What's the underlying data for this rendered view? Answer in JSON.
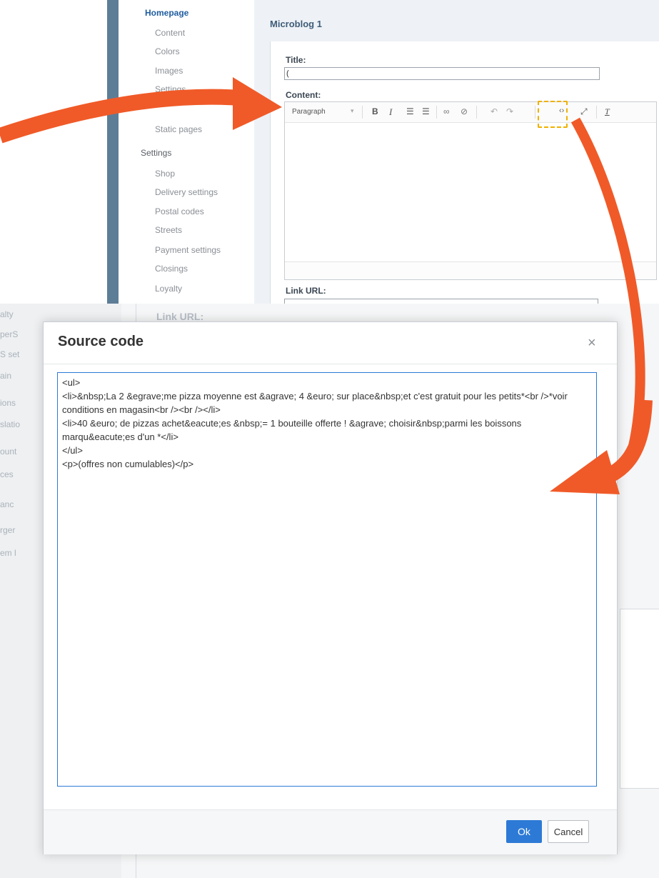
{
  "sidebar": {
    "items": [
      {
        "label": "Homepage",
        "active": true
      },
      {
        "label": "Content"
      },
      {
        "label": "Colors"
      },
      {
        "label": "Images"
      },
      {
        "label": "Settings"
      },
      {
        "label": "Static pages"
      },
      {
        "label": "Settings",
        "section": true
      },
      {
        "label": "Shop"
      },
      {
        "label": "Delivery settings"
      },
      {
        "label": "Postal codes"
      },
      {
        "label": "Streets"
      },
      {
        "label": "Payment settings"
      },
      {
        "label": "Closings"
      },
      {
        "label": "Loyalty"
      }
    ]
  },
  "main": {
    "section_title": "Microblog 1",
    "title_label": "Title:",
    "title_value": "(",
    "content_label": "Content:",
    "link_label": "Link URL:"
  },
  "editor": {
    "block_format": "Paragraph",
    "tools": [
      "bold-icon",
      "italic-icon",
      "ordered-list-icon",
      "bullet-list-icon",
      "link-icon",
      "unlink-icon",
      "undo-icon",
      "redo-icon",
      "source-code-icon",
      "fullscreen-icon",
      "clear-format-icon"
    ],
    "bold_glyph": "B",
    "italic_glyph": "I"
  },
  "lower": {
    "link_label": "Link URL:",
    "left_fragments": [
      "alty",
      "perS",
      "S set",
      "ain",
      "ions",
      "slatio",
      "ount",
      "ces",
      "anc",
      "rger",
      "em l"
    ]
  },
  "modal": {
    "title": "Source code",
    "close": "×",
    "source": "<ul>\n<li>&nbsp;La 2 &egrave;me pizza moyenne est &agrave; 4 &euro; sur place&nbsp;et c'est gratuit pour les petits*<br />*voir conditions en magasin<br /><br /></li>\n<li>40 &euro; de pizzas achet&eacute;es &nbsp;= 1 bouteille offerte ! &agrave; choisir&nbsp;parmi les boissons marqu&eacute;es d'un *</li>\n</ul>\n<p>(offres non cumulables)</p>",
    "ok_label": "Ok",
    "cancel_label": "Cancel"
  },
  "colors": {
    "arrow": "#f05a28",
    "accent": "#2d7ad6",
    "highlight": "#f0b000",
    "sidebar_bar": "#5d7d97"
  }
}
